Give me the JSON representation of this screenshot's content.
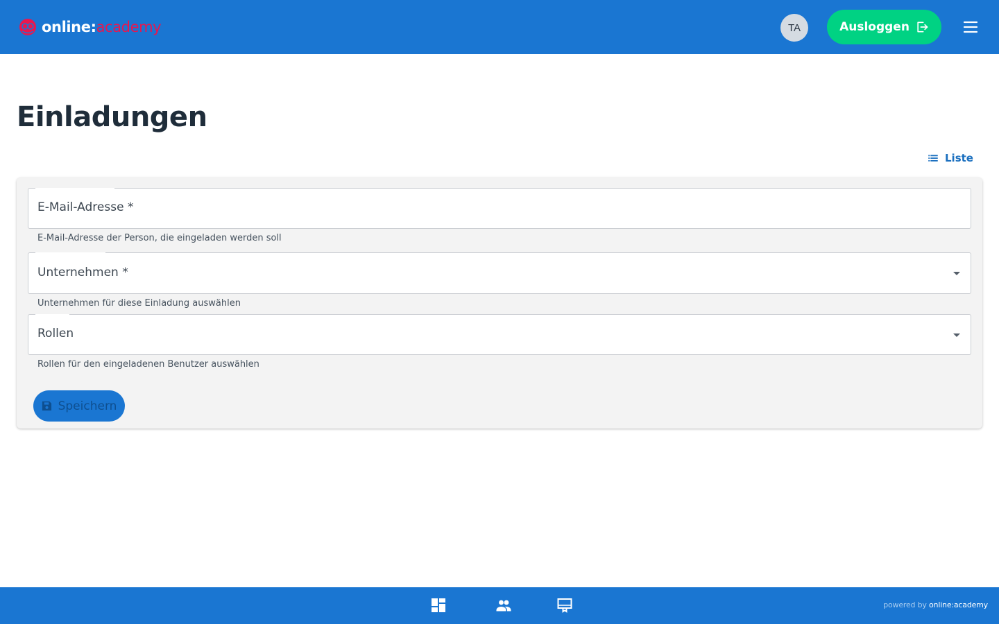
{
  "header": {
    "logo_text_main": "online",
    "logo_text_sep": ":",
    "logo_text_accent": "academy",
    "avatar_initials": "TA",
    "logout_label": "Ausloggen"
  },
  "page": {
    "title": "Einladungen",
    "list_link_label": "Liste"
  },
  "form": {
    "email": {
      "label": "E-Mail-Adresse *",
      "helper": "E-Mail-Adresse der Person, die eingeladen werden soll"
    },
    "company": {
      "label": "Unternehmen *",
      "helper": "Unternehmen für diese Einladung auswählen"
    },
    "roles": {
      "label": "Rollen",
      "helper": "Rollen für den eingeladenen Benutzer auswählen"
    },
    "save_label": "Speichern"
  },
  "footer": {
    "nav_icons": [
      "dashboard-icon",
      "people-icon",
      "presentation-icon"
    ],
    "powered_prefix": "powered by",
    "powered_brand": "online:academy"
  },
  "colors": {
    "primary": "#1a76d2",
    "logout_green": "#00d283",
    "logo_accent": "#e8174f"
  }
}
